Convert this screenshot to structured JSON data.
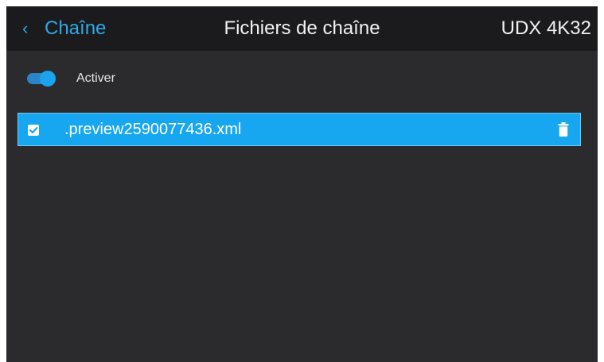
{
  "header": {
    "back_label": "Chaîne",
    "title": "Fichiers de chaîne",
    "device": "UDX 4K32"
  },
  "toggle": {
    "label": "Activer",
    "state": "on"
  },
  "files": [
    {
      "name": ".preview2590077436.xml",
      "checked": true,
      "selected": true
    }
  ],
  "colors": {
    "background": "#2b2b2d",
    "header": "#1b1b1d",
    "accent": "#16a7f0",
    "back_text": "#2fa8e6",
    "text": "#f2f2f2"
  },
  "icons": {
    "back": "chevron-left-icon",
    "checkbox": "checkbox-checked-icon",
    "delete": "trash-icon"
  }
}
